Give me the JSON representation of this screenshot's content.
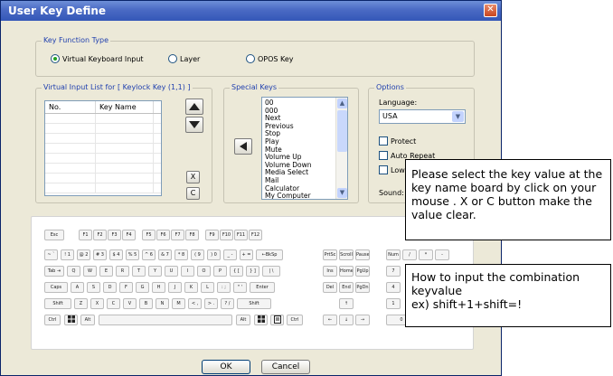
{
  "window": {
    "title": "User Key Define",
    "close_glyph": "✕"
  },
  "key_function_type": {
    "title": "Key Function Type",
    "options": [
      "Virtual Keyboard Input",
      "Layer",
      "OPOS Key"
    ],
    "selected": "Virtual Keyboard Input"
  },
  "input_list": {
    "title": "Virtual Input List for [ Keylock Key (1,1) ]",
    "columns": [
      "No.",
      "Key Name"
    ],
    "x_button": "X",
    "c_button": "C"
  },
  "special_keys": {
    "title": "Special Keys",
    "items": [
      "00",
      "000",
      "Next",
      "Previous",
      "Stop",
      "Play",
      "Mute",
      "Volume Up",
      "Volume Down",
      "Media Select",
      "Mail",
      "Calculator",
      "My Computer"
    ]
  },
  "options": {
    "title": "Options",
    "language_label": "Language:",
    "language_value": "USA",
    "protect": "Protect",
    "auto_repeat": "Auto Repeat",
    "low_speed": "Low S",
    "sound_label": "Sound:"
  },
  "keyboard": {
    "row1": [
      "Esc",
      "F1",
      "F2",
      "F3",
      "F4",
      "F5",
      "F6",
      "F7",
      "F8",
      "F9",
      "F10",
      "F11",
      "F12"
    ],
    "row2": [
      "~ `",
      "! 1",
      "@ 2",
      "# 3",
      "$ 4",
      "% 5",
      "^ 6",
      "& 7",
      "* 8",
      "( 9",
      ") 0",
      "_ -",
      "+ =",
      "←BkSp"
    ],
    "row3": [
      "Tab ⇥",
      "Q",
      "W",
      "E",
      "R",
      "T",
      "Y",
      "U",
      "I",
      "O",
      "P",
      "{ [",
      "} ]",
      "| \\"
    ],
    "row4": [
      "Caps",
      "A",
      "S",
      "D",
      "F",
      "G",
      "H",
      "J",
      "K",
      "L",
      ": ;",
      "\" '",
      "Enter"
    ],
    "row5": [
      "Shift",
      "Z",
      "X",
      "C",
      "V",
      "B",
      "N",
      "M",
      "< ,",
      "> .",
      "? /",
      "Shift"
    ],
    "row6": [
      "Ctrl",
      "win",
      "Alt",
      "",
      "Alt",
      "win",
      "menu",
      "Ctrl"
    ],
    "nav_top": [
      "PrtSc",
      "Scroll",
      "Pause"
    ],
    "nav_mid": [
      "Ins",
      "Home",
      "PgUp"
    ],
    "nav_mid2": [
      "Del",
      "End",
      "PgDn"
    ],
    "arrows": [
      "↑",
      "←",
      "↓",
      "→"
    ],
    "numpad": [
      "Num",
      "/",
      "*",
      "-",
      "7",
      "4",
      "1",
      "0"
    ]
  },
  "buttons": {
    "ok": "OK",
    "cancel": "Cancel"
  },
  "callouts": {
    "first": "Please select the key value at the key name  board by click on your mouse . X or C button  make the value clear.",
    "second_line1": "How to input the combination keyvalue",
    "second_line2": "ex) shift+1+shift=!"
  }
}
